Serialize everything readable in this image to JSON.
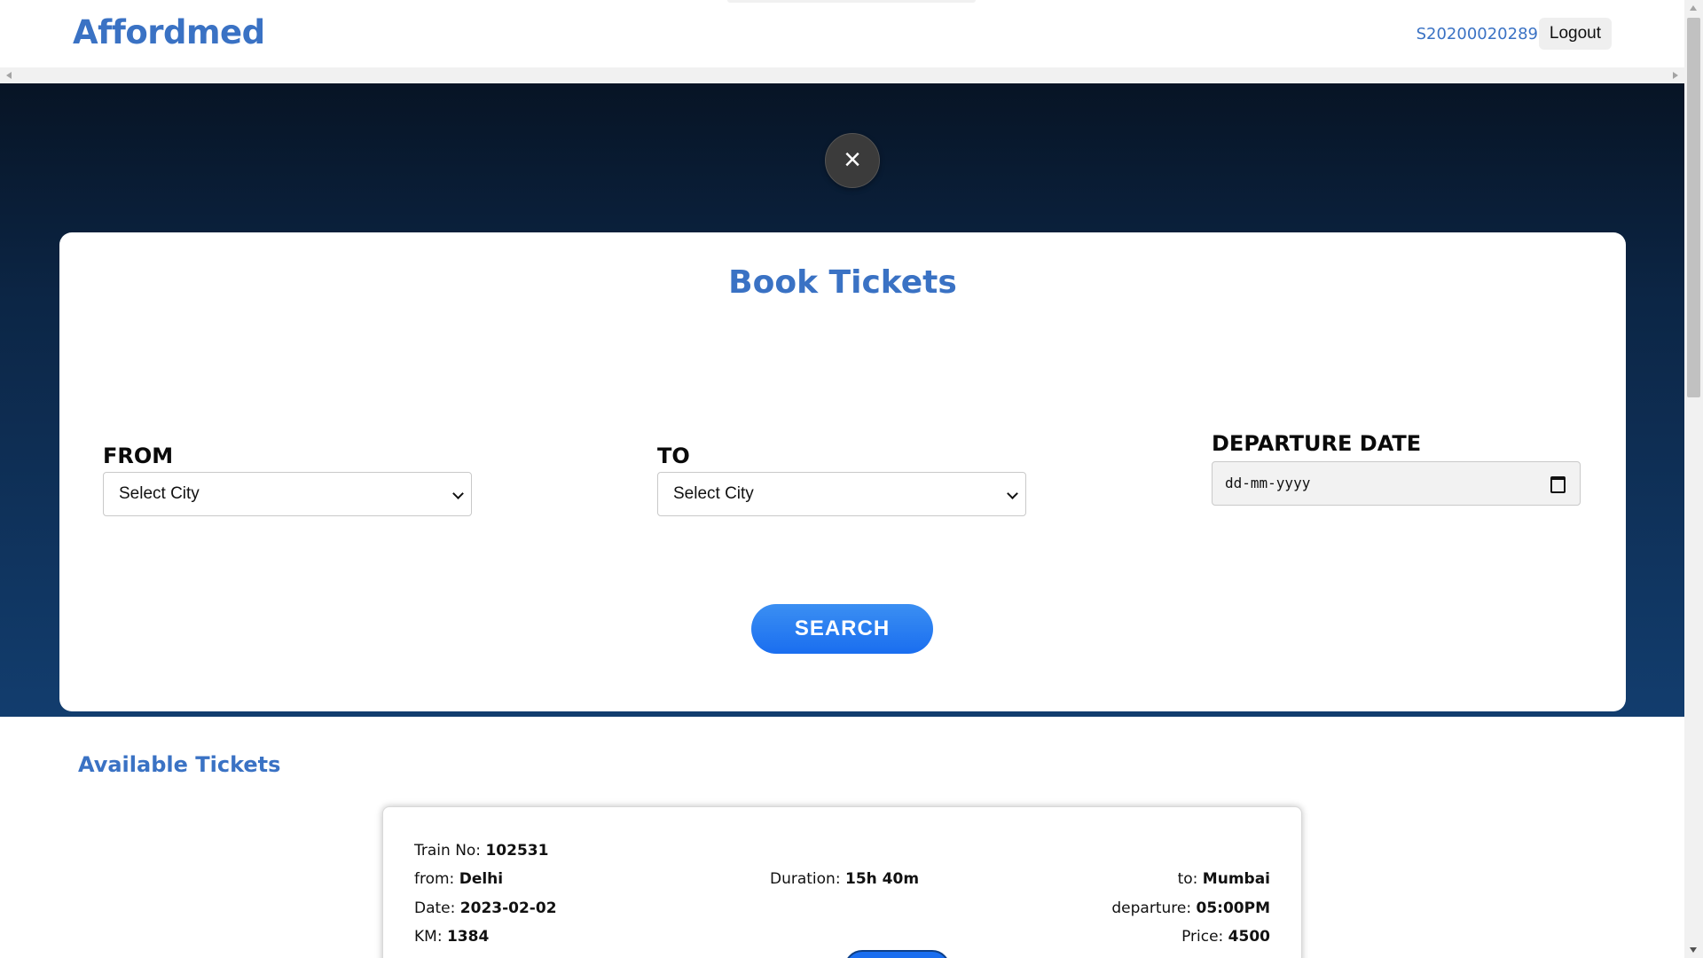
{
  "header": {
    "logo": "Affordmed",
    "user_id": "S20200020289",
    "logout_label": "Logout"
  },
  "overlay": {
    "close_glyph": "×"
  },
  "booking": {
    "title": "Book Tickets",
    "from_label": "FROM",
    "from_value": "Select City",
    "to_label": "TO",
    "to_value": "Select City",
    "date_label": "DEPARTURE DATE",
    "date_placeholder": "dd-mm-yyyy",
    "search_label": "SEARCH"
  },
  "tickets": {
    "section_title": "Available Tickets",
    "items": [
      {
        "train_no_label": "Train No:",
        "train_no": "102531",
        "from_label": "from:",
        "from": "Delhi",
        "date_label": "Date:",
        "date": "2023-02-02",
        "km_label": "KM:",
        "km": "1384",
        "duration_label": "Duration:",
        "duration": "15h 40m",
        "to_label": "to:",
        "to": "Mumbai",
        "departure_label": "departure:",
        "departure": "05:00PM",
        "price_label": "Price:",
        "price": "4500"
      }
    ]
  },
  "colors": {
    "brand": "#3a72c4",
    "hero_top": "#071425",
    "hero_bottom": "#123d6e",
    "search_button": "#1a6ef0"
  },
  "icons": {
    "close": "close-icon",
    "chevron": "chevron-down-icon",
    "calendar": "calendar-icon"
  }
}
